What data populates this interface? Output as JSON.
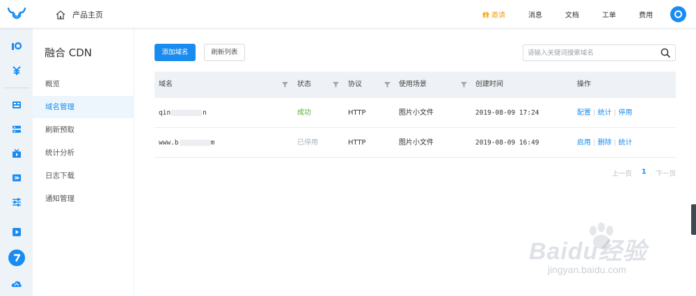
{
  "topbar": {
    "home_label": "产品主页",
    "nav": [
      {
        "label": "邀请",
        "icon": "gift-icon",
        "color": "#f0a21a"
      },
      {
        "label": "消息"
      },
      {
        "label": "文档"
      },
      {
        "label": "工单"
      },
      {
        "label": "费用"
      }
    ],
    "avatar_icon": "user-avatar-icon"
  },
  "rail": {
    "icons": [
      "overview-icon",
      "billing-icon",
      "storage-icon",
      "database-icon",
      "media-icon",
      "transcode-icon",
      "settings-sliders-icon",
      "video-icon",
      "cdn-icon",
      "cloud-icon"
    ]
  },
  "subnav": {
    "title": "融合 CDN",
    "items": [
      "概览",
      "域名管理",
      "刷新预取",
      "统计分析",
      "日志下载",
      "通知管理"
    ],
    "active_index": 1
  },
  "toolbar": {
    "add_label": "添加域名",
    "refresh_label": "刷新列表",
    "search_placeholder": "请输入关键词搜索域名"
  },
  "table": {
    "columns": [
      "域名",
      "状态",
      "协议",
      "使用场景",
      "创建时间",
      "操作"
    ],
    "rows": [
      {
        "domain_start": "qin",
        "domain_end": "n",
        "status": "成功",
        "protocol": "HTTP",
        "scene": "图片小文件",
        "created": "2019-08-09 17:24",
        "actions": [
          "配置",
          "统计",
          "停用"
        ]
      },
      {
        "domain_start": "www.b",
        "domain_end": "m",
        "status": "已停用",
        "protocol": "HTTP",
        "scene": "图片小文件",
        "created": "2019-08-09 16:49",
        "actions": [
          "启用",
          "删除",
          "统计"
        ]
      }
    ]
  },
  "pager": {
    "prev": "上一页",
    "page": "1",
    "next": "下一页"
  },
  "watermark": {
    "brand": "Baidu经验",
    "url": "jingyan.baidu.com"
  },
  "colors": {
    "primary": "#1a8cf0",
    "success": "#5aad3e",
    "disabled": "#a9b2bc"
  }
}
